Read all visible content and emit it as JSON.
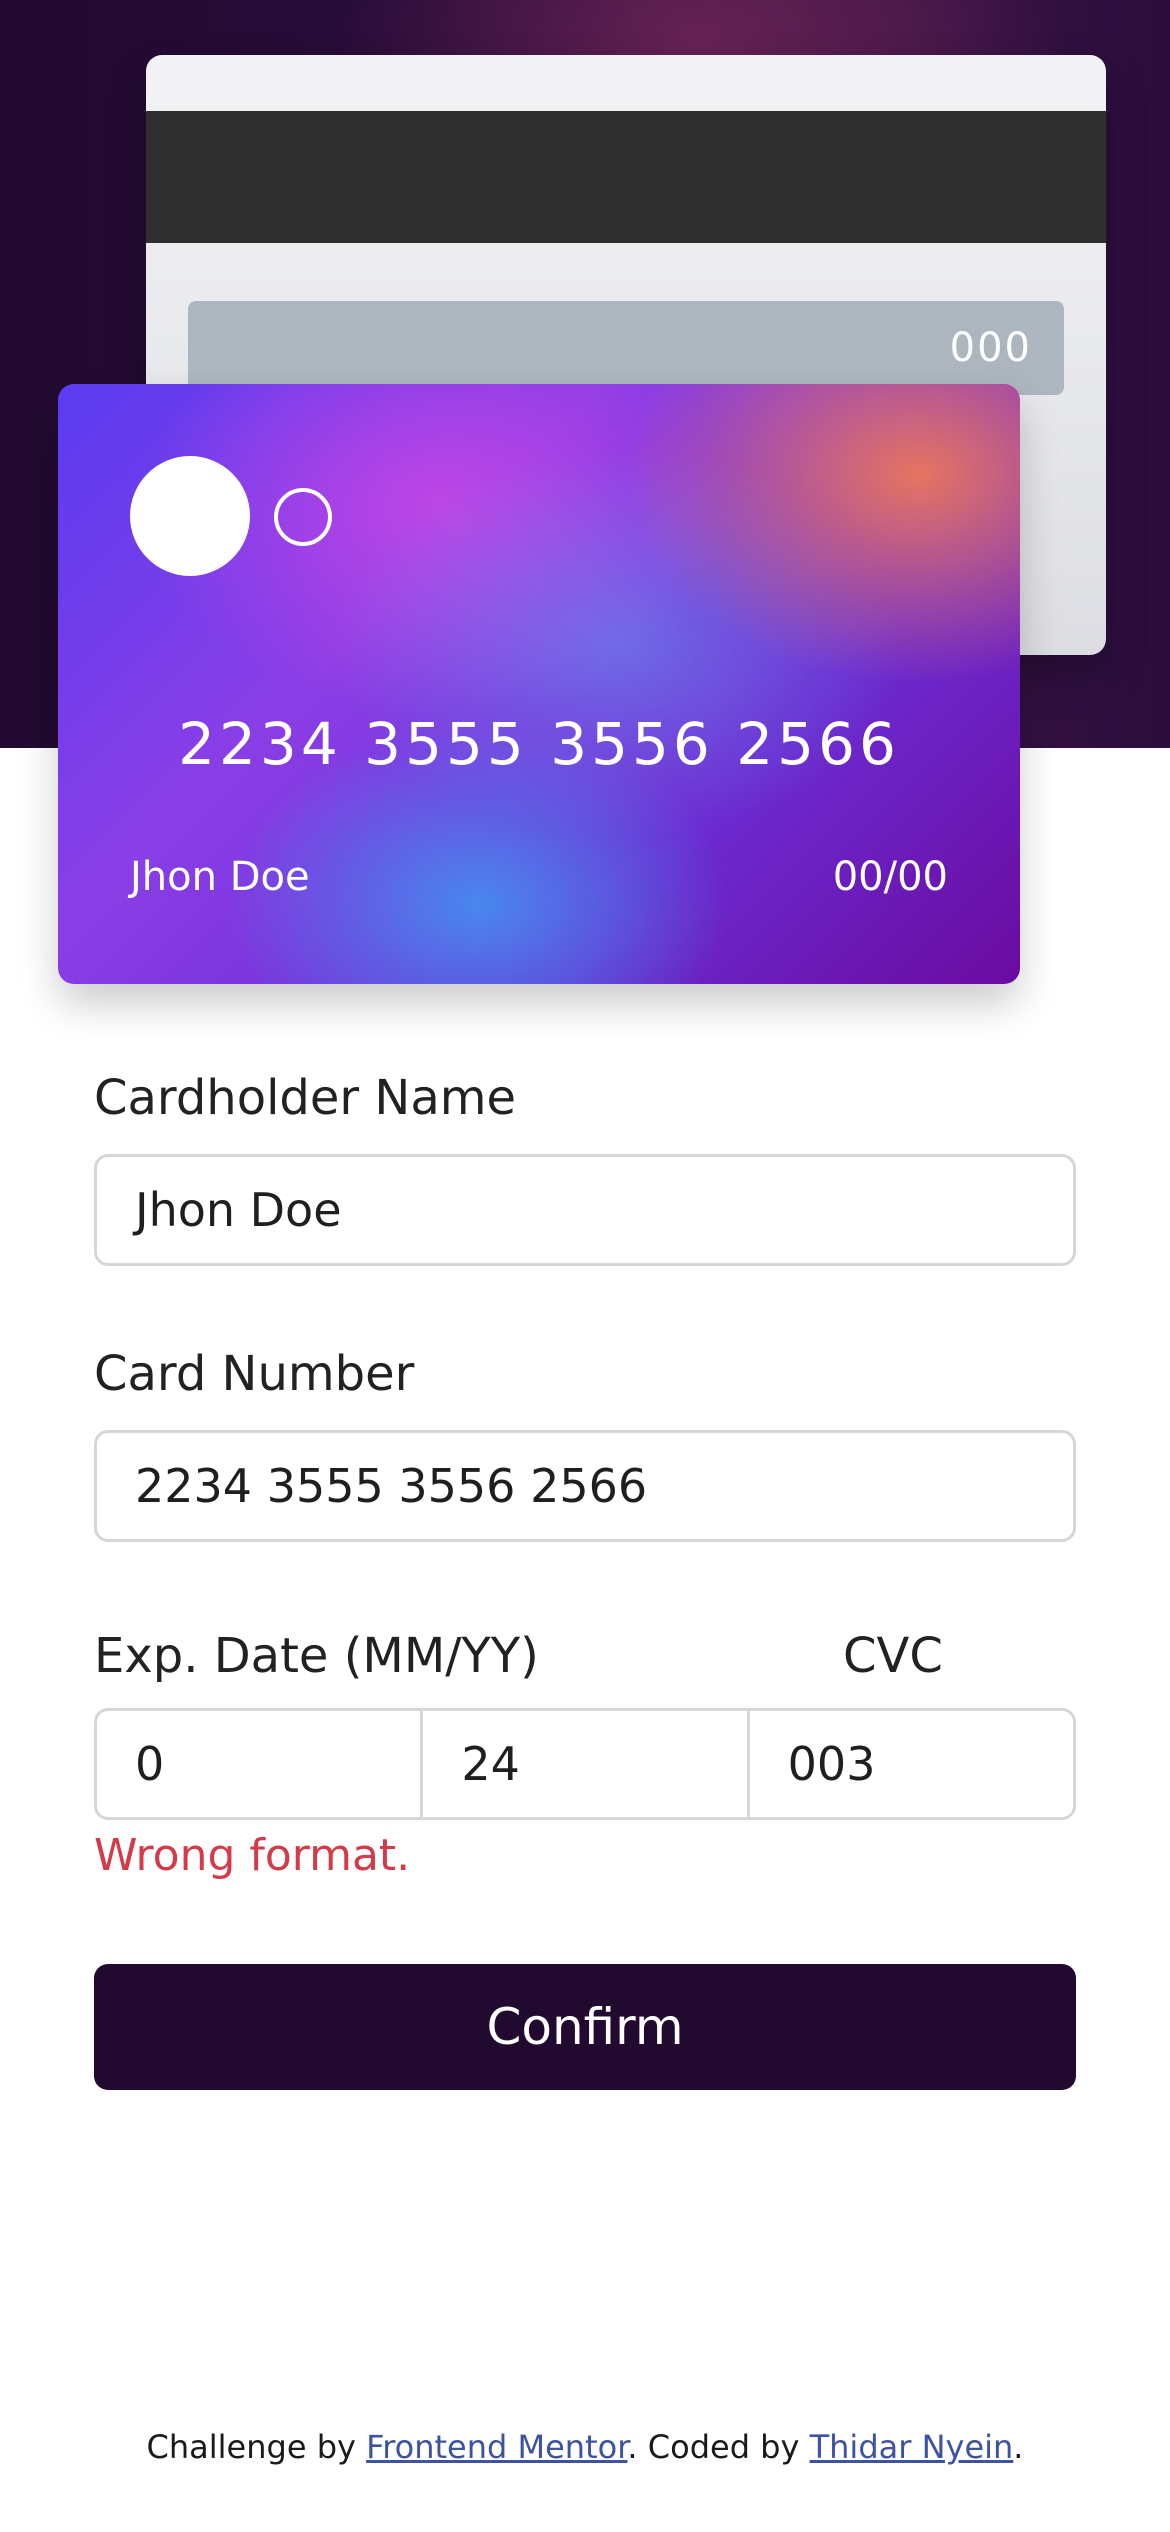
{
  "card_back": {
    "cvc": "000"
  },
  "card_front": {
    "number": "2234 3555 3556 2566",
    "name": "Jhon Doe",
    "expiry": "00/00"
  },
  "form": {
    "name_label": "Cardholder Name",
    "name_value": "Jhon Doe",
    "number_label": "Card Number",
    "number_value": "2234 3555 3556 2566",
    "exp_label": "Exp. Date (MM/YY)",
    "exp_month": "0",
    "exp_year": "24",
    "cvc_label": "CVC",
    "cvc_value": "003",
    "error": "Wrong format.",
    "confirm_label": "Confirm"
  },
  "footer": {
    "prefix": "Challenge by ",
    "link1": "Frontend Mentor",
    "middle": ". Coded by ",
    "link2": "Thidar Nyein",
    "suffix": "."
  },
  "colors": {
    "hero": "#220a30",
    "button": "#220930",
    "error": "#d43b4a",
    "link": "#3e52a3"
  }
}
